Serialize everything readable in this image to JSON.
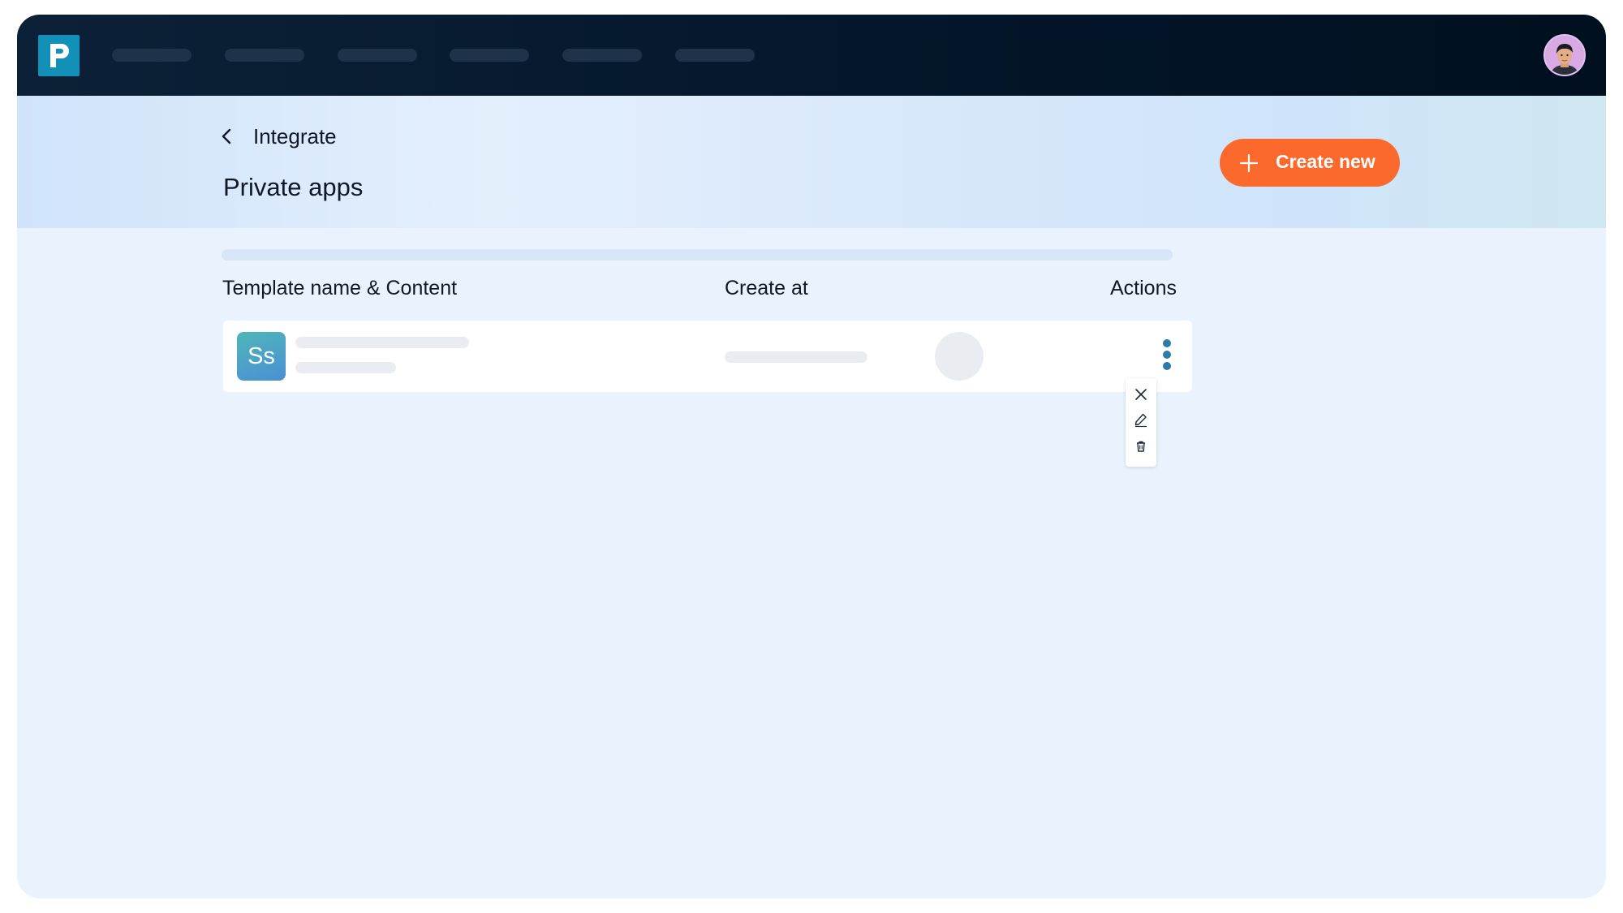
{
  "header": {
    "breadcrumb": "Integrate",
    "title": "Private apps",
    "create_button_label": "Create new"
  },
  "table": {
    "columns": [
      "Template name & Content",
      "Create at",
      "Actions"
    ],
    "rows": [
      {
        "app_icon_text": "Ss"
      }
    ]
  },
  "row_menu": {
    "items": [
      "close-icon",
      "edit-icon",
      "delete-icon"
    ]
  },
  "icons": {
    "logo": "logo-icon",
    "back": "chevron-left-icon",
    "create": "plus-icon",
    "actions": "more-vertical-icon"
  },
  "colors": {
    "topbar": "#03152a",
    "accent": "#fb6a2c",
    "logo": "#1390b8",
    "kebab": "#2e7aa8",
    "background": "#eaf3fd"
  }
}
